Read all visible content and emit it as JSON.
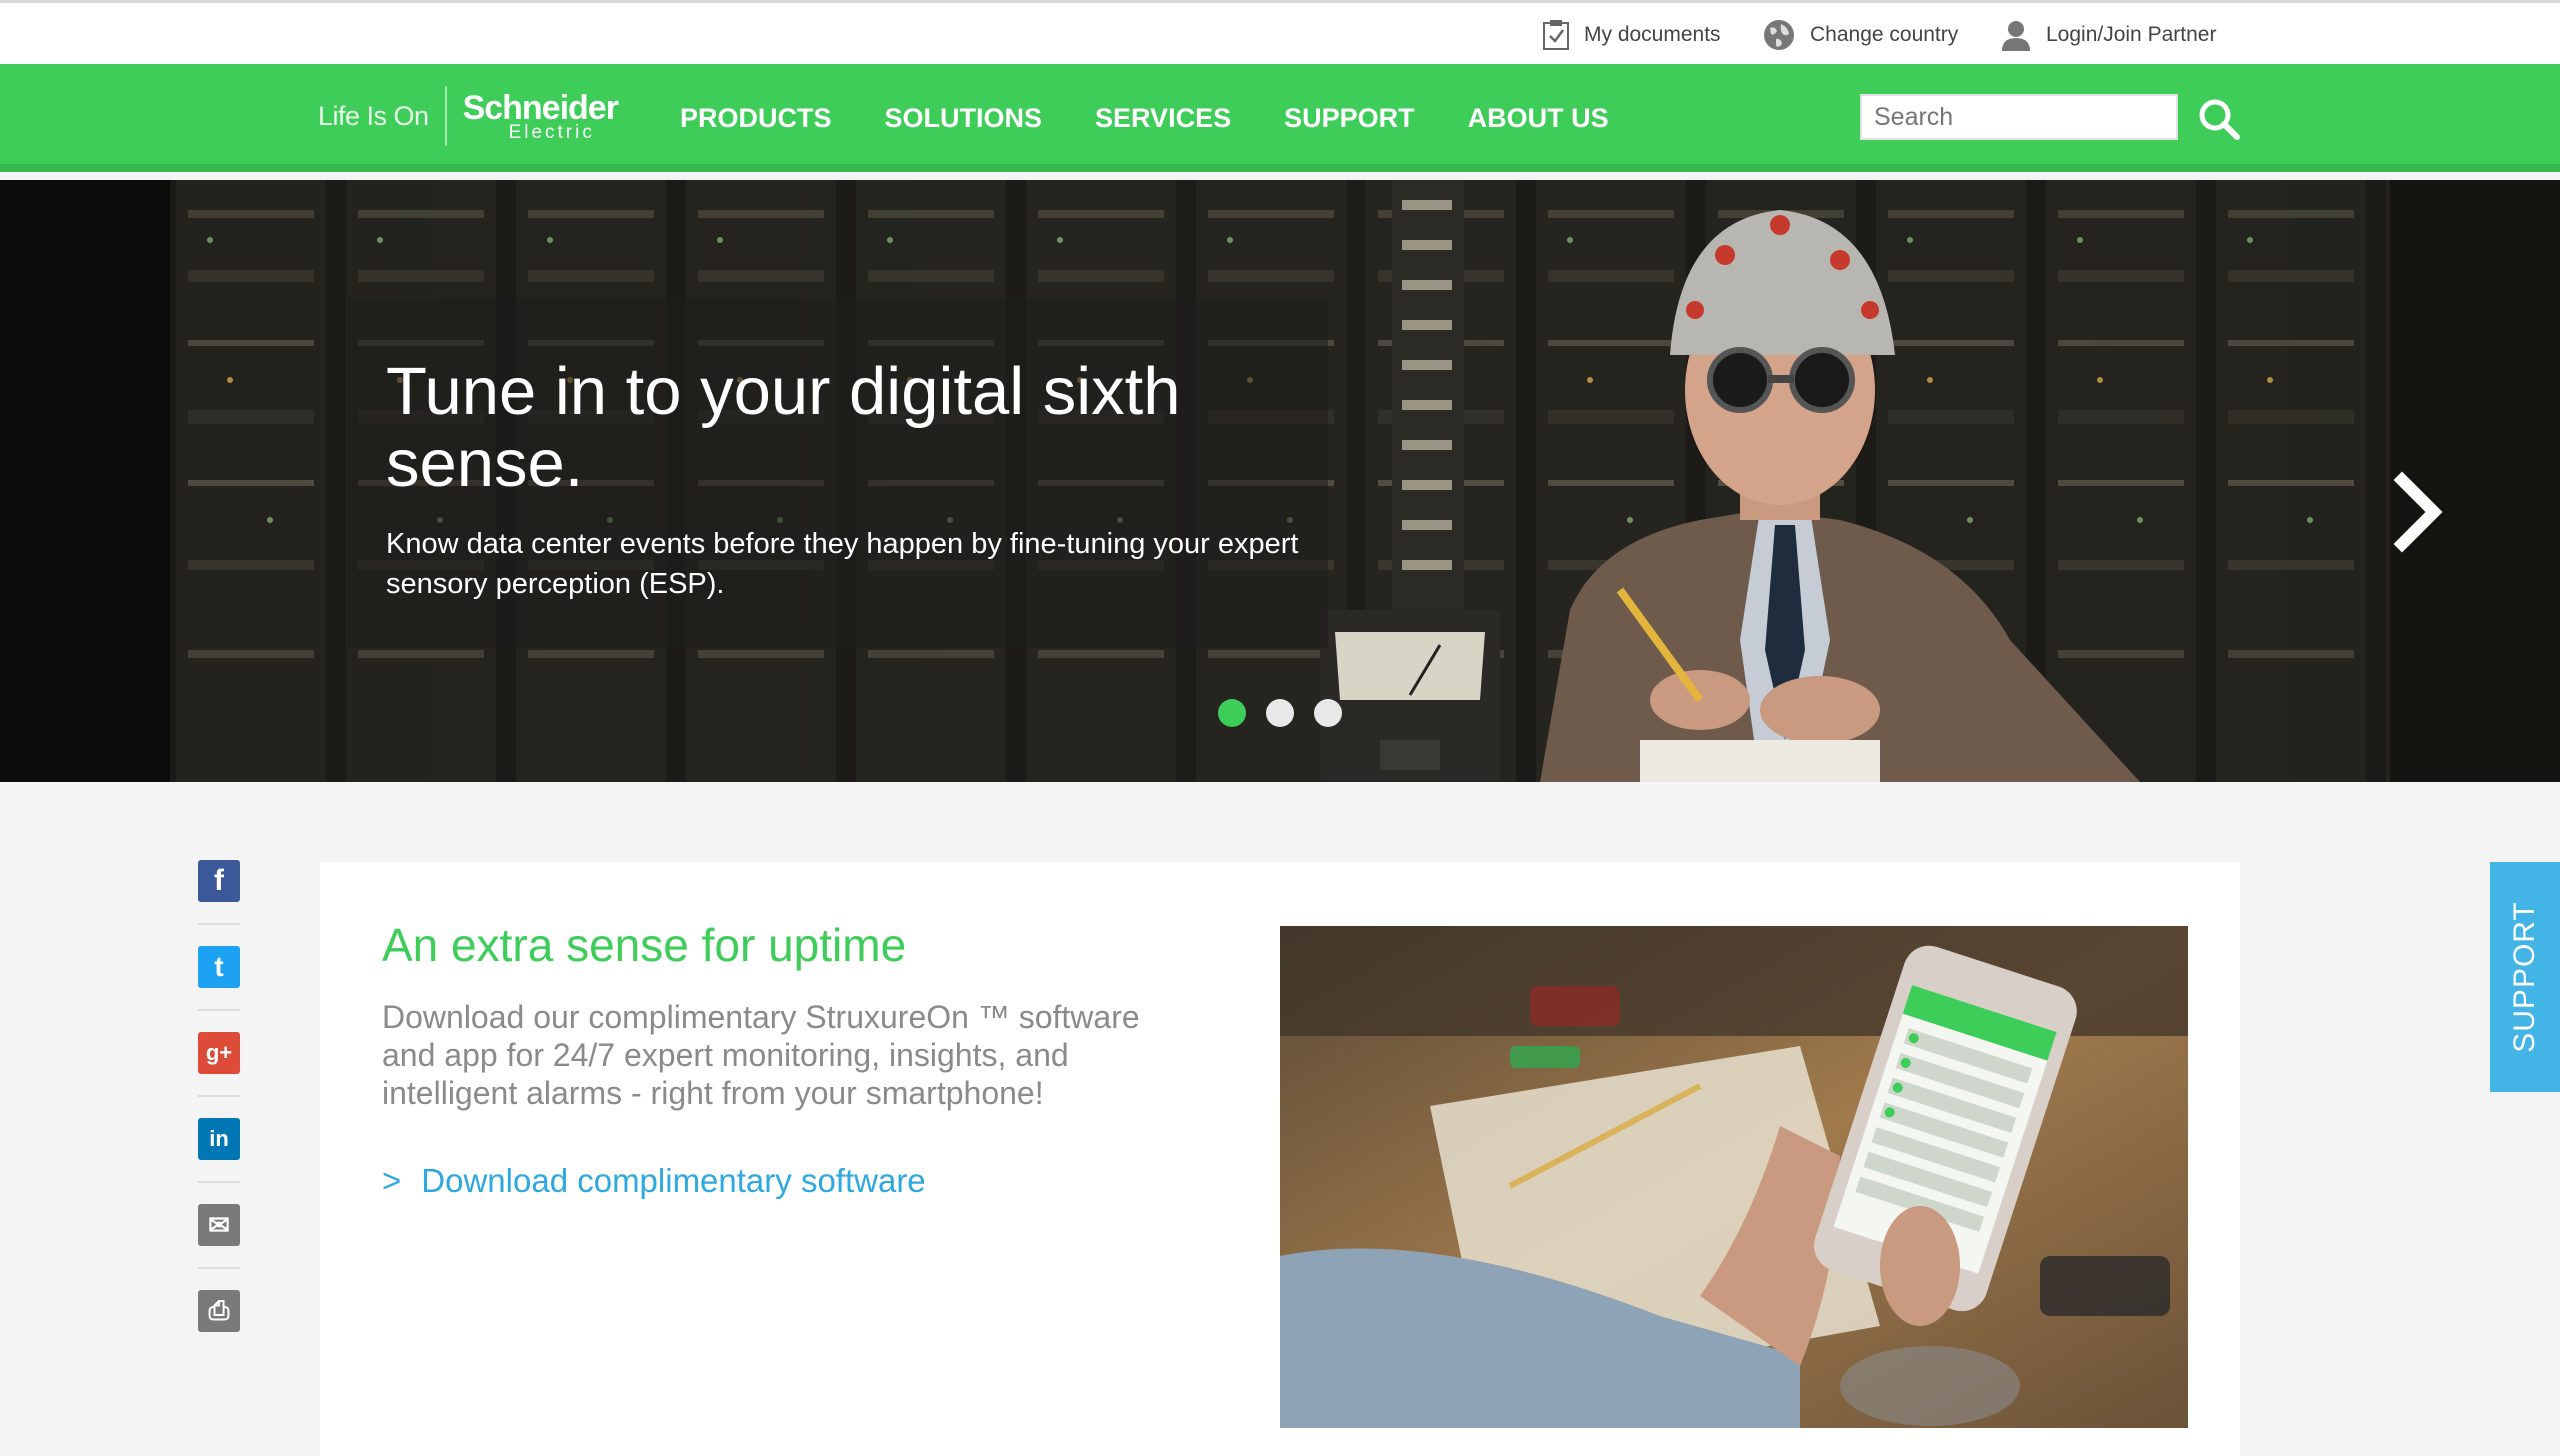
{
  "utility": {
    "my_documents": "My documents",
    "change_country": "Change country",
    "login": "Login/Join Partner"
  },
  "brand": {
    "tagline": "Life Is On",
    "logo_name": "Schneider",
    "logo_sub": "Electric"
  },
  "nav": {
    "items": [
      "PRODUCTS",
      "SOLUTIONS",
      "SERVICES",
      "SUPPORT",
      "ABOUT US"
    ]
  },
  "search": {
    "placeholder": "Search"
  },
  "hero": {
    "title": "Tune in to your digital sixth sense.",
    "subtitle": "Know data center events before they happen by fine-tuning your expert sensory perception (ESP).",
    "slides": 3,
    "active_slide": 1
  },
  "social": {
    "items": [
      {
        "icon": "facebook-icon",
        "glyph": "f",
        "color": "#3b5998"
      },
      {
        "icon": "twitter-icon",
        "glyph": "t",
        "color": "#1da1f2"
      },
      {
        "icon": "google-plus-icon",
        "glyph": "g+",
        "color": "#dd4b39"
      },
      {
        "icon": "linkedin-icon",
        "glyph": "in",
        "color": "#0077b5"
      },
      {
        "icon": "email-icon",
        "glyph": "✉",
        "color": "#7a7a7a"
      },
      {
        "icon": "print-icon",
        "glyph": "⎙",
        "color": "#7a7a7a"
      }
    ]
  },
  "feature": {
    "title": "An extra sense for uptime",
    "text": "Download our complimentary StruxureOn ™ software and app for 24/7 expert monitoring, insights, and intelligent alarms - right from your smartphone!",
    "link_chevron": ">",
    "link_label": "Download complimentary software"
  },
  "support_tab": {
    "label": "SUPPORT"
  },
  "colors": {
    "brand_green": "#3dcd58",
    "link_blue": "#2ea8e0",
    "support_blue": "#42b4e6"
  }
}
